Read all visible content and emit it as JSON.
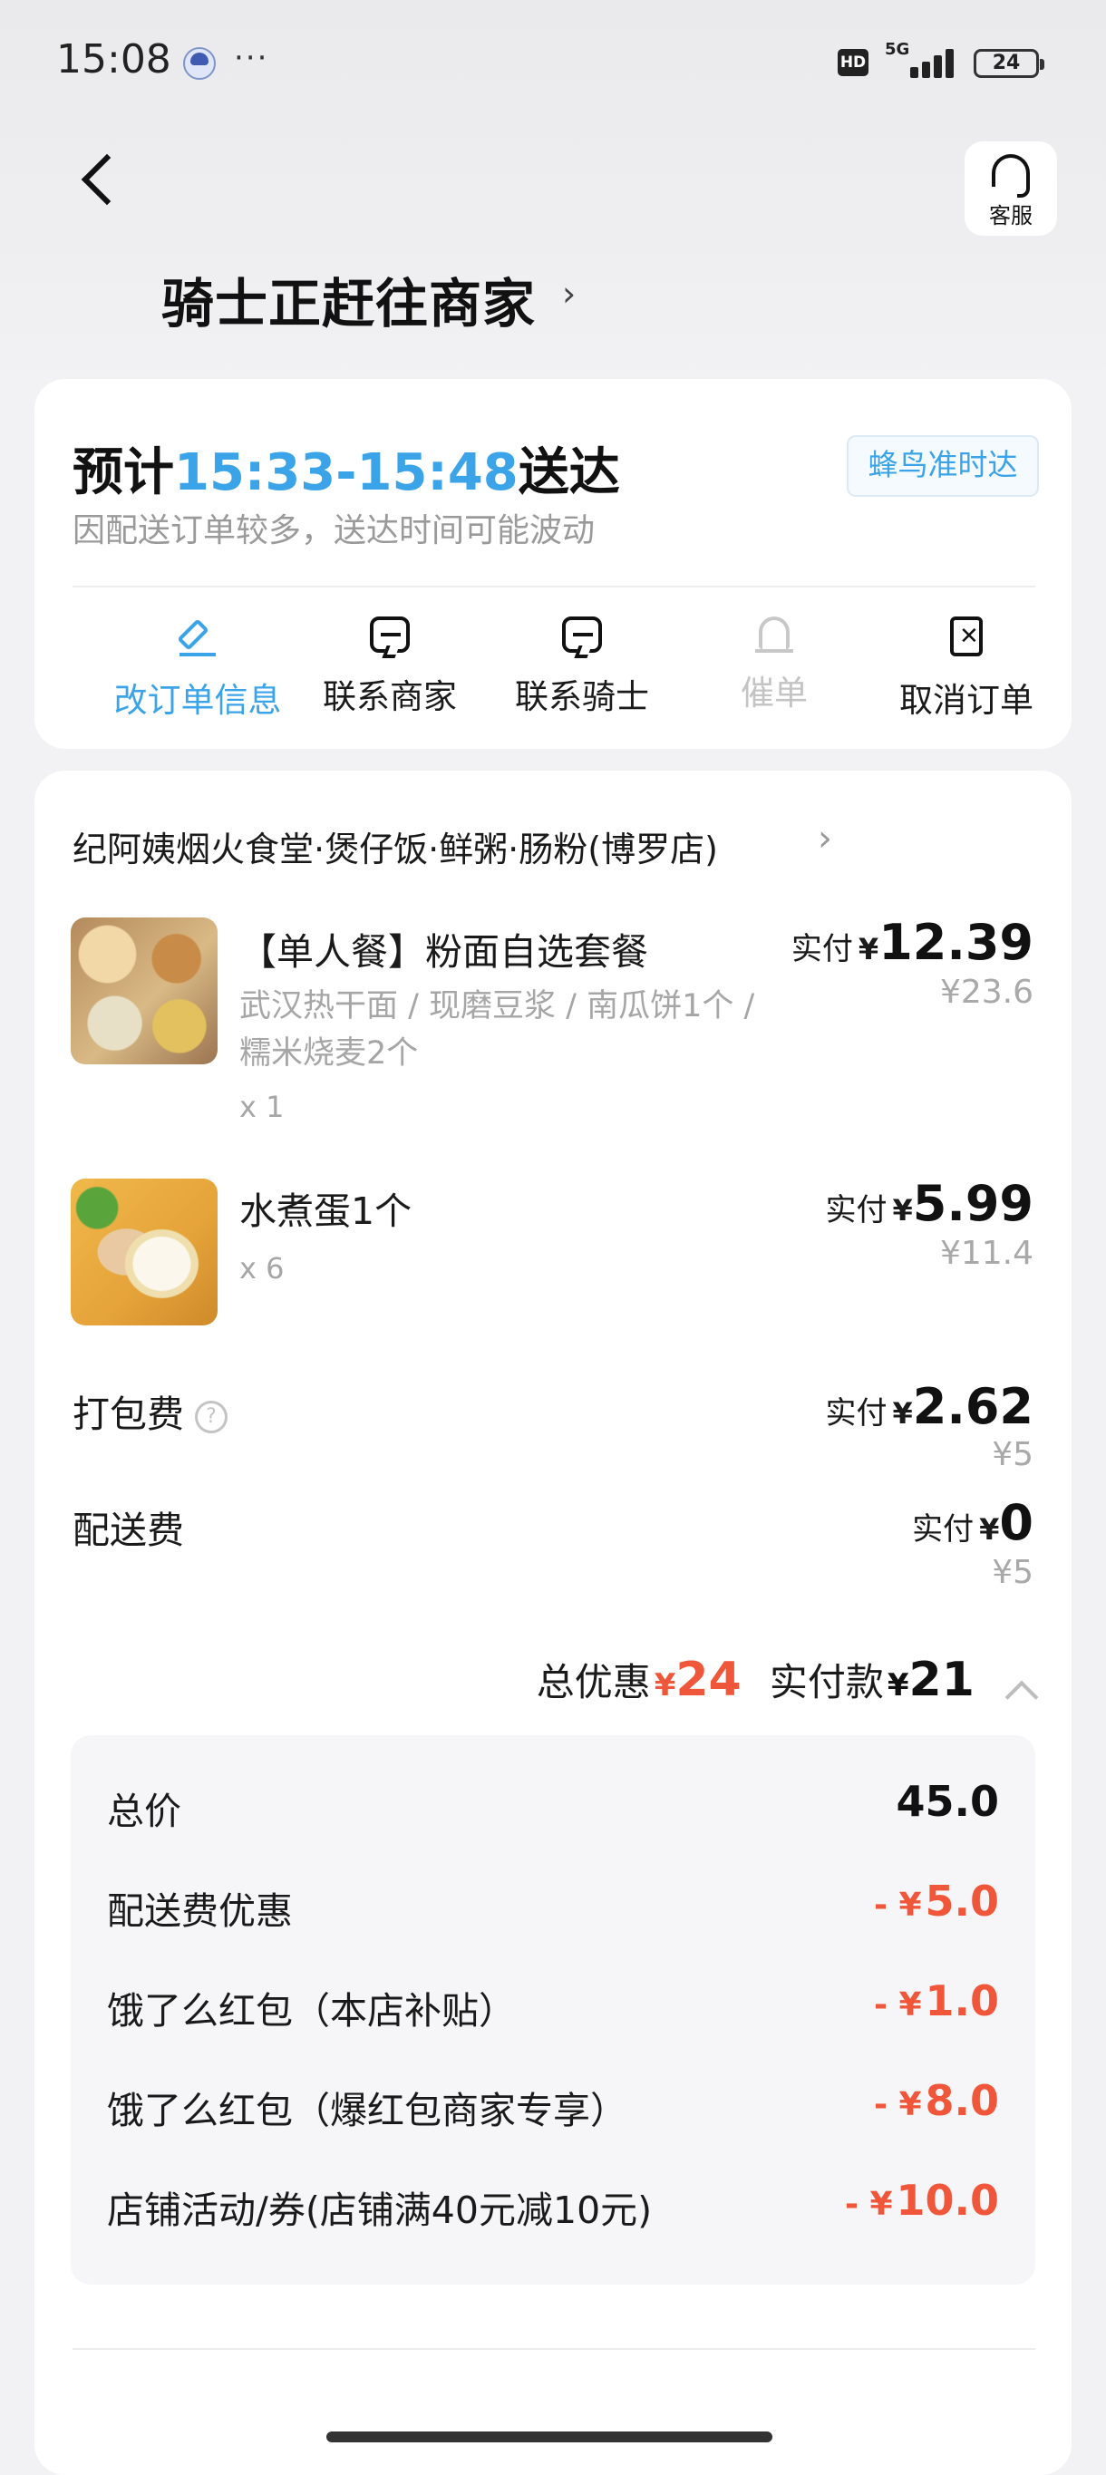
{
  "status_bar": {
    "time": "15:08",
    "dots": "···",
    "hd": "HD",
    "network": "5G",
    "battery": "24"
  },
  "header": {
    "service_label": "客服",
    "status_title": "骑士正赶往商家"
  },
  "eta_card": {
    "prefix": "预计",
    "time_range": "15:33-15:48",
    "suffix": "送达",
    "badge": "蜂鸟准时达",
    "note": "因配送订单较多，送达时间可能波动",
    "actions": [
      {
        "label": "改订单信息",
        "icon": "edit-icon",
        "state": "active"
      },
      {
        "label": "联系商家",
        "icon": "chat-icon",
        "state": "normal"
      },
      {
        "label": "联系骑士",
        "icon": "chat-icon",
        "state": "normal"
      },
      {
        "label": "催单",
        "icon": "bell-icon",
        "state": "disabled"
      },
      {
        "label": "取消订单",
        "icon": "cancel-order-icon",
        "state": "normal"
      }
    ]
  },
  "order": {
    "shop_name": "纪阿姨烟火食堂·煲仔饭·鲜粥·肠粉(博罗店)",
    "items": [
      {
        "name": "【单人餐】粉面自选套餐",
        "desc": "武汉热干面 / 现磨豆浆 / 南瓜饼1个 / 糯米烧麦2个",
        "qty": "x 1",
        "pay_label": "实付",
        "currency": "¥",
        "pay": "12.39",
        "original": "¥23.6"
      },
      {
        "name": "水煮蛋1个",
        "desc": "",
        "qty": "x 6",
        "pay_label": "实付",
        "currency": "¥",
        "pay": "5.99",
        "original": "¥11.4"
      }
    ],
    "packing_fee": {
      "label": "打包费",
      "help": "?",
      "pay_label": "实付",
      "currency": "¥",
      "pay": "2.62",
      "original": "¥5"
    },
    "delivery_fee": {
      "label": "配送费",
      "pay_label": "实付",
      "currency": "¥",
      "pay": "0",
      "original": "¥5"
    },
    "summary": {
      "discount_label": "总优惠",
      "discount_currency": "¥",
      "discount": "24",
      "paid_label": "实付款",
      "paid_currency": "¥",
      "paid": "21"
    },
    "breakdown": [
      {
        "label": "总价",
        "value": "45.0",
        "negative": false
      },
      {
        "label": "配送费优惠",
        "value": "5.0",
        "negative": true
      },
      {
        "label": "饿了么红包（本店补贴）",
        "value": "1.0",
        "negative": true
      },
      {
        "label": "饿了么红包（爆红包商家专享）",
        "value": "8.0",
        "negative": true
      },
      {
        "label": "店铺活动/券(店铺满40元减10元)",
        "value": "10.0",
        "negative": true
      }
    ],
    "negative_prefix": "- ¥"
  },
  "colors": {
    "accent_blue": "#3ba4e8",
    "discount_red": "#f0573a",
    "muted_gray": "#a6a6a6"
  }
}
